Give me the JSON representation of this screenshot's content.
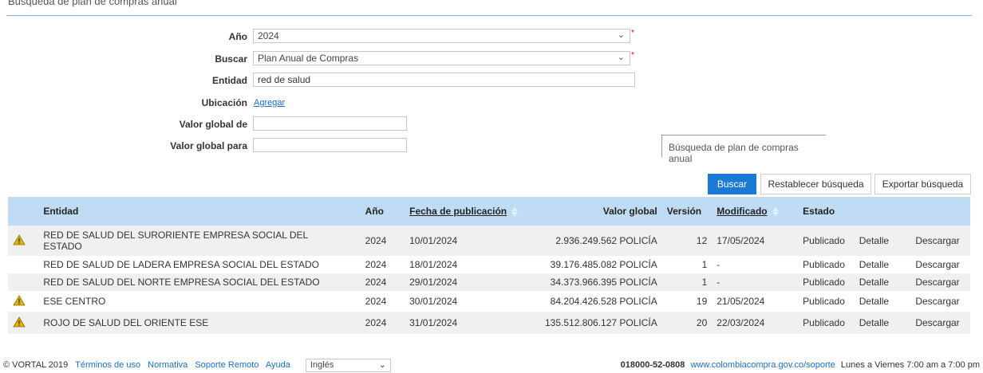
{
  "section": {
    "title": "Búsqueda de plan de compras anual"
  },
  "form": {
    "year_label": "Año",
    "year_value": "2024",
    "search_label": "Buscar",
    "search_value": "Plan Anual de Compras",
    "entity_label": "Entidad",
    "entity_value": "red de salud",
    "location_label": "Ubicación",
    "location_link": "Agregar",
    "value_from_label": "Valor global de",
    "value_from_value": "",
    "value_to_label": "Valor global para",
    "value_to_value": "",
    "required_mark": "*"
  },
  "tooltip": {
    "text": "Búsqueda de plan de compras anual"
  },
  "buttons": {
    "search": "Buscar",
    "reset": "Restablecer búsqueda",
    "export": "Exportar búsqueda"
  },
  "table": {
    "headers": {
      "entity": "Entidad",
      "year": "Año",
      "pub_date": "Fecha de publicación",
      "global_value": "Valor global",
      "version": "Versión",
      "modified": "Modificado",
      "status": "Estado"
    },
    "rows": [
      {
        "warning": true,
        "entity_line1": "RED DE SALUD DEL SURORIENTE EMPRESA SOCIAL DEL",
        "entity_line2": "ESTADO",
        "year": "2024",
        "pub_date": "10/01/2024",
        "value": "2.936.249.562 POLICÍA",
        "version": "12",
        "modified": "17/05/2024",
        "status": "Publicado",
        "detail": "Detalle",
        "download": "Descargar"
      },
      {
        "warning": false,
        "entity": "RED DE SALUD DE LADERA EMPRESA SOCIAL DEL ESTADO",
        "year": "2024",
        "pub_date": "18/01/2024",
        "value": "39.176.485.082 POLICÍA",
        "version": "1",
        "modified": "-",
        "status": "Publicado",
        "detail": "Detalle",
        "download": "Descargar"
      },
      {
        "warning": false,
        "entity": "RED DE SALUD DEL NORTE EMPRESA SOCIAL DEL ESTADO",
        "year": "2024",
        "pub_date": "29/01/2024",
        "value": "34.373.966.395 POLICÍA",
        "version": "1",
        "modified": "-",
        "status": "Publicado",
        "detail": "Detalle",
        "download": "Descargar"
      },
      {
        "warning": true,
        "entity": "ESE CENTRO",
        "year": "2024",
        "pub_date": "30/01/2024",
        "value": "84.204.426.528 POLICÍA",
        "version": "19",
        "modified": "21/05/2024",
        "status": "Publicado",
        "detail": "Detalle",
        "download": "Descargar"
      },
      {
        "warning": true,
        "entity": "ROJO DE SALUD DEL ORIENTE ESE",
        "year": "2024",
        "pub_date": "31/01/2024",
        "value": "135.512.806.127 POLICÍA",
        "version": "20",
        "modified": "22/03/2024",
        "status": "Publicado",
        "detail": "Detalle",
        "download": "Descargar"
      }
    ]
  },
  "footer": {
    "copyright": "© VORTAL 2019",
    "terms": "Términos de uso",
    "normative": "Normativa",
    "remote_support": "Soporte Remoto",
    "help": "Ayuda",
    "language": "Inglés",
    "phone": "018000-52-0808",
    "support_url": "www.colombiacompra.gov.co/soporte",
    "hours": "Lunes a Viernes 7:00 am a 7:00 pm"
  },
  "colors": {
    "accent": "#1a7ad6",
    "header_bg": "#bfdcf4",
    "link": "#1a6fc9",
    "warning": "#e0b400"
  }
}
